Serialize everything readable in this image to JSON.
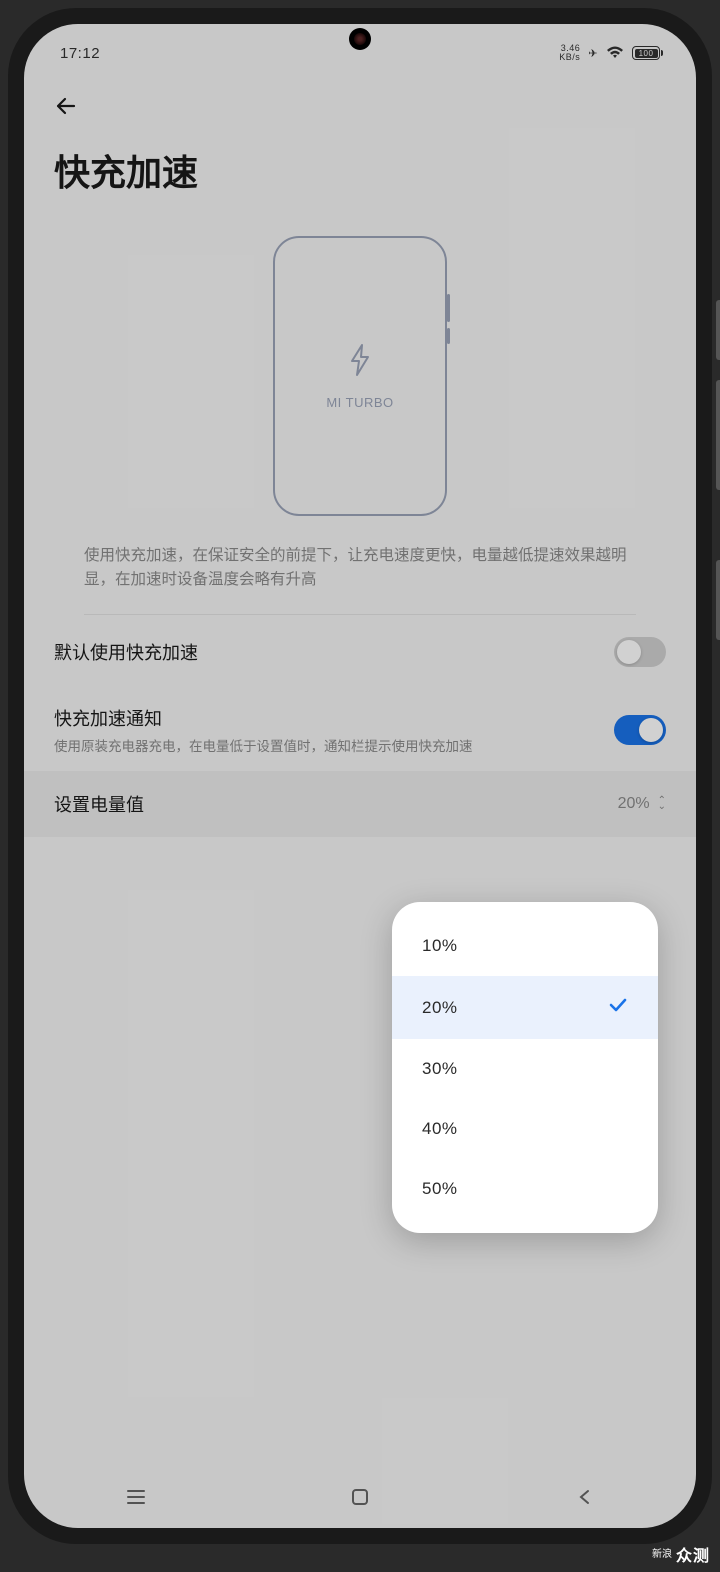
{
  "status": {
    "time": "17:12",
    "net_speed": "3.46",
    "net_unit": "KB/s",
    "battery_level": "100"
  },
  "page": {
    "title": "快充加速",
    "turbo_label": "MI TURBO",
    "description": "使用快充加速，在保证安全的前提下，让充电速度更快，电量越低提速效果越明显，在加速时设备温度会略有升高"
  },
  "settings": {
    "default_fast_charge": {
      "title": "默认使用快充加速",
      "enabled": false
    },
    "notification": {
      "title": "快充加速通知",
      "subtitle": "使用原装充电器充电，在电量低于设置值时，通知栏提示使用快充加速",
      "enabled": true
    },
    "threshold": {
      "title": "设置电量值",
      "value": "20%"
    }
  },
  "dropdown": {
    "options": [
      "10%",
      "20%",
      "30%",
      "40%",
      "50%"
    ],
    "selected_index": 1
  },
  "watermark": {
    "brand_small": "新浪",
    "brand_big": "众测"
  }
}
